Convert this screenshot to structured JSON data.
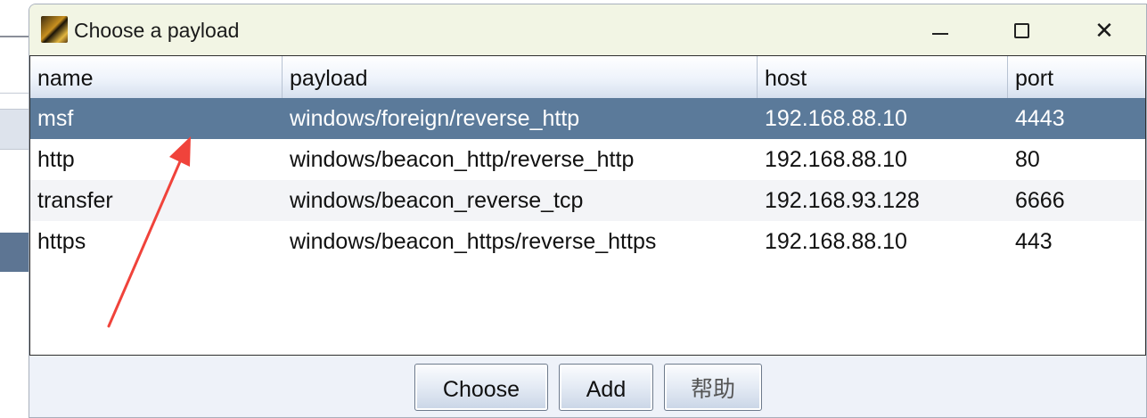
{
  "window": {
    "title": "Choose a payload",
    "controls": {
      "minimize": "minimize",
      "maximize": "maximize",
      "close": "✕"
    }
  },
  "table": {
    "columns": [
      "name",
      "payload",
      "host",
      "port"
    ],
    "rows": [
      {
        "name": "msf",
        "payload": "windows/foreign/reverse_http",
        "host": "192.168.88.10",
        "port": "4443",
        "selected": true
      },
      {
        "name": "http",
        "payload": "windows/beacon_http/reverse_http",
        "host": "192.168.88.10",
        "port": "80"
      },
      {
        "name": "transfer",
        "payload": "windows/beacon_reverse_tcp",
        "host": "192.168.93.128",
        "port": "6666"
      },
      {
        "name": "https",
        "payload": "windows/beacon_https/reverse_https",
        "host": "192.168.88.10",
        "port": "443"
      }
    ]
  },
  "buttons": {
    "choose": "Choose",
    "add": "Add",
    "help": "帮助"
  },
  "colors": {
    "selection": "#5b7a9a",
    "arrow": "#f0433b",
    "titlebar": "#f2f5e4"
  },
  "icons": {
    "app": "cobalt-strike-app-icon",
    "annotation": "red-arrow-annotation"
  }
}
